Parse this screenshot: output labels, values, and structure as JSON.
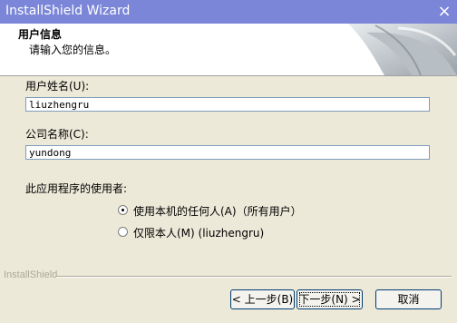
{
  "window": {
    "title": "InstallShield Wizard",
    "close_glyph": "×"
  },
  "header": {
    "title": "用户信息",
    "subtitle": "请输入您的信息。"
  },
  "form": {
    "username_label": "用户姓名(U):",
    "username_value": "liuzhengru",
    "company_label": "公司名称(C):",
    "company_value": "yundong",
    "question": "此应用程序的使用者:",
    "options": [
      {
        "label": "使用本机的任何人(A)（所有用户）",
        "selected": true
      },
      {
        "label": "仅限本人(M) (liuzhengru)",
        "selected": false
      }
    ]
  },
  "footer": {
    "brand": "InstallShield",
    "back_label": "< 上一步(B)",
    "next_label": "下一步(N) >",
    "cancel_label": "取消"
  },
  "colors": {
    "titlebar": "#7b86d8",
    "dialog_bg": "#ece9d8"
  }
}
